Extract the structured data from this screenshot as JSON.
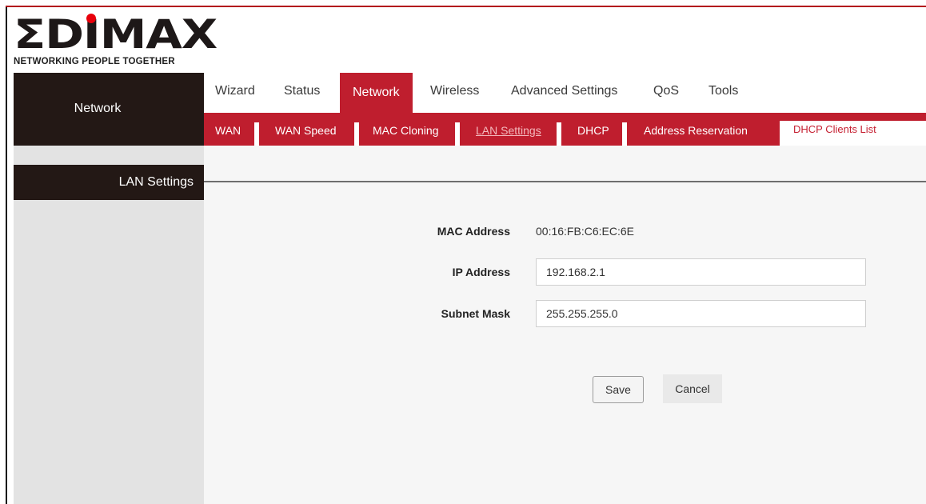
{
  "brand": {
    "name": "EDIMAX",
    "tagline": "NETWORKING PEOPLE TOGETHER",
    "accent_color": "#bf1e2e",
    "dark_color": "#231815"
  },
  "sidebar": {
    "section_title": "Network",
    "current_page": "LAN Settings"
  },
  "topnav": {
    "tabs": [
      {
        "label": "Wizard",
        "active": false
      },
      {
        "label": "Status",
        "active": false
      },
      {
        "label": "Network",
        "active": true
      },
      {
        "label": "Wireless",
        "active": false
      },
      {
        "label": "Advanced Settings",
        "active": false
      },
      {
        "label": "QoS",
        "active": false
      },
      {
        "label": "Tools",
        "active": false
      }
    ]
  },
  "subnav": {
    "items": [
      {
        "label": "WAN",
        "current": false
      },
      {
        "label": "WAN Speed",
        "current": false
      },
      {
        "label": "MAC Cloning",
        "current": false
      },
      {
        "label": "LAN Settings",
        "current": true
      },
      {
        "label": "DHCP",
        "current": false
      },
      {
        "label": "Address Reservation",
        "current": false
      },
      {
        "label": "DHCP Clients List",
        "current": false
      }
    ]
  },
  "form": {
    "mac_label": "MAC Address",
    "mac_value": "00:16:FB:C6:EC:6E",
    "ip_label": "IP Address",
    "ip_value": "192.168.2.1",
    "mask_label": "Subnet Mask",
    "mask_value": "255.255.255.0",
    "save_label": "Save",
    "cancel_label": "Cancel"
  }
}
